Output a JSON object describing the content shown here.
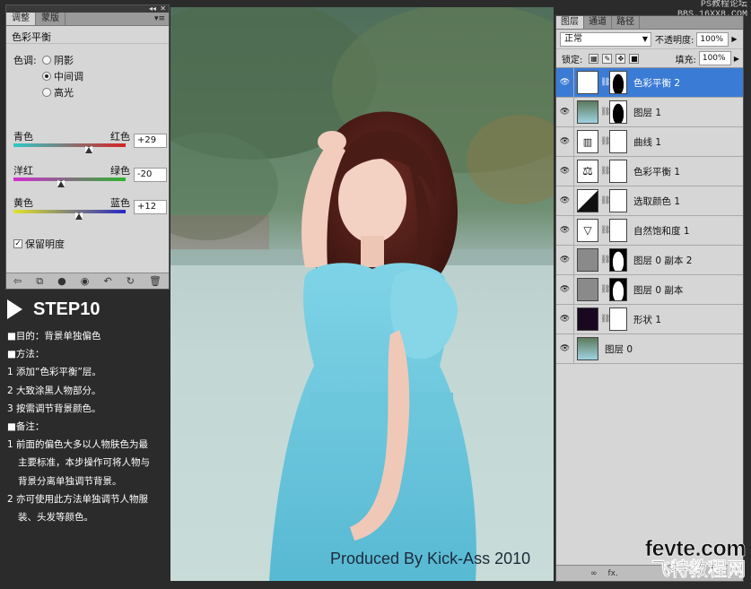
{
  "adjustments": {
    "tabs": [
      "调整",
      "蒙版"
    ],
    "title": "色彩平衡",
    "tone_label": "色调:",
    "tones": [
      {
        "label": "阴影",
        "selected": false
      },
      {
        "label": "中间调",
        "selected": true
      },
      {
        "label": "高光",
        "selected": false
      }
    ],
    "sliders": [
      {
        "left": "青色",
        "right": "红色",
        "value": "+29",
        "level": 29
      },
      {
        "left": "洋红",
        "right": "绿色",
        "value": "-20",
        "level": -20
      },
      {
        "left": "黄色",
        "right": "蓝色",
        "value": "+12",
        "level": 12
      }
    ],
    "preserve_luminosity": {
      "label": "保留明度",
      "checked": true
    },
    "footer_icons": [
      "back-icon",
      "clip-icon",
      "visibility-mask-icon",
      "eye-icon",
      "reset-icon",
      "refresh-icon",
      "trash-icon"
    ]
  },
  "notes": {
    "step": "STEP10",
    "lines": [
      {
        "text": "■目的：背景单独偏色",
        "indent": false
      },
      {
        "text": "■方法：",
        "indent": false
      },
      {
        "text": "1 添加“色彩平衡”层。",
        "indent": false
      },
      {
        "text": "2 大致涂黑人物部分。",
        "indent": false
      },
      {
        "text": "3 按需调节背景颜色。",
        "indent": false
      },
      {
        "text": "■备注：",
        "indent": false
      },
      {
        "text": "1 前面的偏色大多以人物肤色为最",
        "indent": false
      },
      {
        "text": "主要标准，本步操作可将人物与",
        "indent": true
      },
      {
        "text": "背景分离单独调节背景。",
        "indent": true
      },
      {
        "text": "2 亦可使用此方法单独调节人物服",
        "indent": false
      },
      {
        "text": "装、头发等颜色。",
        "indent": true
      }
    ]
  },
  "photo": {
    "watermark": "Produced By Kick-Ass 2010"
  },
  "layers": {
    "tabs": [
      "图层",
      "通道",
      "路径"
    ],
    "blend_mode": "正常",
    "opacity_label": "不透明度:",
    "opacity": "100%",
    "lock_label": "锁定:",
    "fill_label": "填充:",
    "fill": "100%",
    "items": [
      {
        "name": "色彩平衡 2",
        "thumb": "balance",
        "mask": "person",
        "active": true
      },
      {
        "name": "图层 1",
        "thumb": "photo",
        "mask": "person",
        "active": false
      },
      {
        "name": "曲线 1",
        "thumb": "curves",
        "mask": "white",
        "active": false
      },
      {
        "name": "色彩平衡 1",
        "thumb": "balance",
        "mask": "white",
        "active": false
      },
      {
        "name": "选取颜色 1",
        "thumb": "selective",
        "mask": "white",
        "active": false
      },
      {
        "name": "自然饱和度 1",
        "thumb": "vibrance",
        "mask": "white",
        "active": false
      },
      {
        "name": "图层 0 副本 2",
        "thumb": "gray",
        "mask": "person-inv",
        "active": false
      },
      {
        "name": "图层 0 副本",
        "thumb": "gray",
        "mask": "person-inv",
        "active": false
      },
      {
        "name": "形状 1",
        "thumb": "dark",
        "mask": "white",
        "active": false
      },
      {
        "name": "图层 0",
        "thumb": "photo",
        "mask": "none",
        "active": false
      }
    ],
    "footer": [
      "∞",
      "fx."
    ]
  },
  "site": {
    "top1": "PS教程论坛",
    "top2": "BBS.16XX8.COM",
    "bottom1": "fevte.com",
    "bottom2": "飞特教程网"
  }
}
